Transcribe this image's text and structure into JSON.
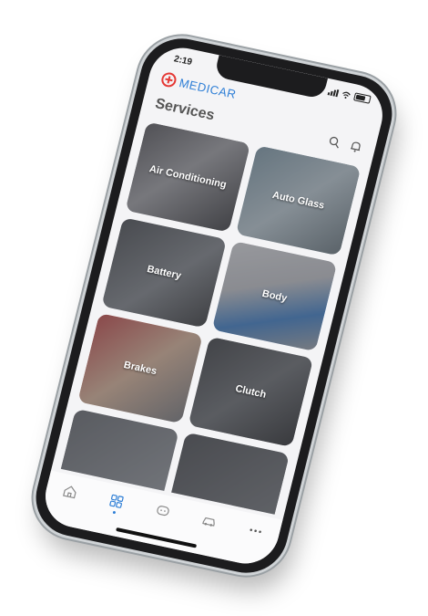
{
  "status": {
    "time": "2:19"
  },
  "brand": {
    "name": "MEDICAR",
    "color": "#2f7fd6",
    "logo_color": "#e53935"
  },
  "page": {
    "title": "Services"
  },
  "header_icons": [
    "search-icon",
    "bell-icon"
  ],
  "services": [
    {
      "label": "Air Conditioning"
    },
    {
      "label": "Auto Glass"
    },
    {
      "label": "Battery"
    },
    {
      "label": "Body"
    },
    {
      "label": "Brakes"
    },
    {
      "label": "Clutch"
    },
    {
      "label": ""
    },
    {
      "label": ""
    }
  ],
  "tabs": [
    {
      "icon": "home-icon"
    },
    {
      "icon": "grid-icon",
      "active": true
    },
    {
      "icon": "chat-icon"
    },
    {
      "icon": "car-icon"
    },
    {
      "icon": "more-icon"
    }
  ]
}
